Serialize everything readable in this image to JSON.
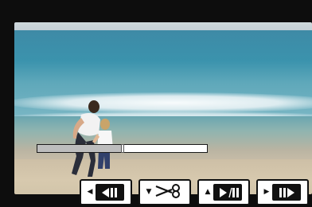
{
  "playback": {
    "progress_fraction": 0.5
  },
  "controls": {
    "items": [
      {
        "name": "frame-back",
        "direction": "left",
        "icon": "frame-back-icon"
      },
      {
        "name": "cut",
        "direction": "down",
        "icon": "scissors-icon"
      },
      {
        "name": "play-pause",
        "direction": "up",
        "icon": "play-pause-icon"
      },
      {
        "name": "frame-forward",
        "direction": "right",
        "icon": "frame-forward-icon"
      }
    ]
  }
}
